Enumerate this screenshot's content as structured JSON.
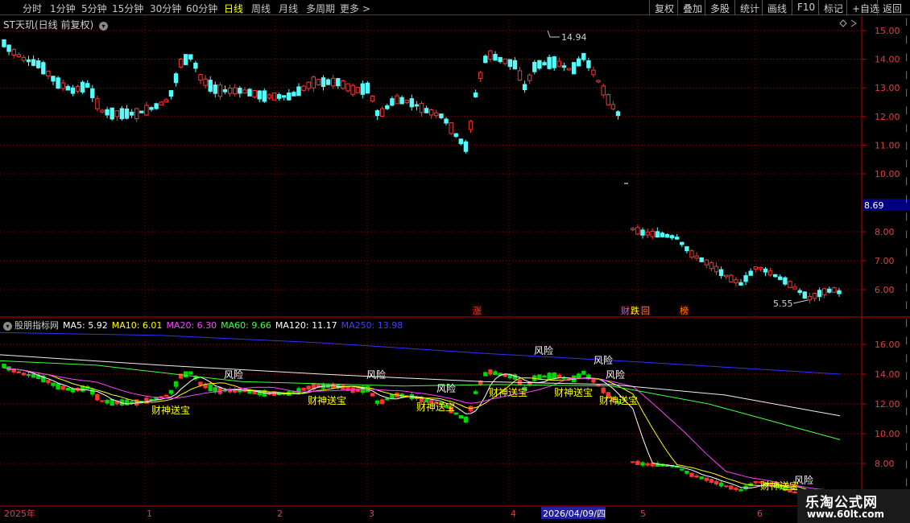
{
  "toolbar": {
    "periods": [
      {
        "label": "分时",
        "active": false
      },
      {
        "label": "1分钟",
        "active": false
      },
      {
        "label": "5分钟",
        "active": false
      },
      {
        "label": "15分钟",
        "active": false
      },
      {
        "label": "30分钟",
        "active": false
      },
      {
        "label": "60分钟",
        "active": false
      },
      {
        "label": "日线",
        "active": true
      },
      {
        "label": "周线",
        "active": false
      },
      {
        "label": "月线",
        "active": false
      },
      {
        "label": "多周期",
        "active": false
      },
      {
        "label": "更多 >",
        "active": false
      }
    ],
    "right_buttons": [
      "复权",
      "叠加",
      "多股",
      "统计",
      "画线",
      "F10",
      "标记",
      "+自选",
      "返回"
    ]
  },
  "stock_title": "ST天玑(日线 前复权)",
  "price_axis": [
    "15.00",
    "14.00",
    "13.00",
    "12.00",
    "11.00",
    "10.00",
    "8.00",
    "7.00",
    "6.00"
  ],
  "current_price": "8.69",
  "high_marker": "14.94",
  "low_marker": "5.55",
  "event_tags": [
    {
      "text": "涨",
      "color": "#ff3030"
    },
    {
      "text": "财",
      "color": "#6080ff"
    },
    {
      "text": "跌",
      "color": "#ffff00"
    },
    {
      "text": "回",
      "color": "#ff8000"
    },
    {
      "text": "榜",
      "color": "#ff8000"
    }
  ],
  "indicator": {
    "name": "股朋指标网",
    "ma": [
      {
        "label": "MA5: 5.92",
        "color": "#ffffff"
      },
      {
        "label": "MA10: 6.01",
        "color": "#ffff00"
      },
      {
        "label": "MA20: 6.30",
        "color": "#ff40ff"
      },
      {
        "label": "MA60: 9.66",
        "color": "#40ff40"
      },
      {
        "label": "MA120: 11.17",
        "color": "#ffffff"
      },
      {
        "label": "MA250: 13.98",
        "color": "#4040ff"
      }
    ],
    "axis": [
      "16.00",
      "14.00",
      "12.00",
      "10.00",
      "8.00"
    ],
    "signal_risk": "风险",
    "signal_wealth": "财神送宝"
  },
  "dates": [
    {
      "text": "2025年",
      "highlight": false
    },
    {
      "text": "1",
      "highlight": false
    },
    {
      "text": "2",
      "highlight": false
    },
    {
      "text": "3",
      "highlight": false
    },
    {
      "text": "4",
      "highlight": false
    },
    {
      "text": "2026/04/09/四",
      "highlight": true
    },
    {
      "text": "5",
      "highlight": false
    },
    {
      "text": "6",
      "highlight": false
    }
  ],
  "watermark": {
    "title": "乐淘公式网",
    "url": "www.60lt.com"
  },
  "colors": {
    "up": "#ff3232",
    "down": "#54fcfc",
    "down_ind": "#00d800",
    "grid": "#8b0000"
  }
}
